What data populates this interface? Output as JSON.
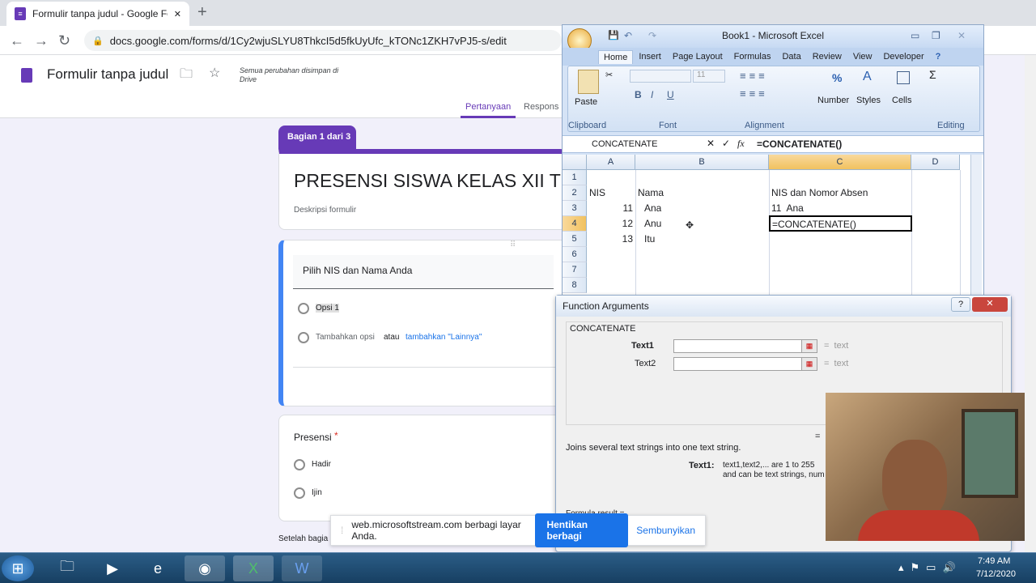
{
  "browser": {
    "tab_title": "Formulir tanpa judul - Google Fo",
    "tab_close": "✕",
    "new_tab": "+",
    "url": "docs.google.com/forms/d/1Cy2wjuSLYU8ThkcI5d5fkUyUfc_kTONc1ZKH7vPJ5-s/edit"
  },
  "forms": {
    "doc_title": "Formulir tanpa judul",
    "save_status": "Semua perubahan disimpan di Drive",
    "tabs": [
      "Pertanyaan",
      "Respons"
    ],
    "section_badge": "Bagian 1 dari 3",
    "form_title": "PRESENSI SISWA KELAS XII TEI",
    "form_description": "Deskripsi formulir",
    "question1": {
      "title": "Pilih NIS dan Nama Anda",
      "option1": "Opsi 1",
      "add_option": "Tambahkan opsi",
      "atau": "atau",
      "add_other": "tambahkan \"Lainnya\""
    },
    "question2": {
      "title": "Presensi",
      "required_mark": "*",
      "options": [
        "Hadir",
        "Ijin"
      ]
    },
    "after_section": "Setelah bagia"
  },
  "excel": {
    "title": "Book1 - Microsoft Excel",
    "ribbon_tabs": [
      "Home",
      "Insert",
      "Page Layout",
      "Formulas",
      "Data",
      "Review",
      "View",
      "Developer"
    ],
    "groups": {
      "clipboard": "Clipboard",
      "font": "Font",
      "alignment": "Alignment",
      "number": "Number",
      "styles": "Styles",
      "cells": "Cells",
      "editing": "Editing",
      "paste": "Paste",
      "font_size": "11"
    },
    "name_box": "CONCATENATE",
    "formula": "=CONCATENATE()",
    "columns": [
      "A",
      "B",
      "C",
      "D"
    ],
    "rows": [
      "1",
      "2",
      "3",
      "4",
      "5",
      "6",
      "7",
      "8"
    ],
    "cells": {
      "A2": "NIS",
      "B2": "Nama",
      "C2": "NIS dan Nomor Absen",
      "A3": "11",
      "B3": "Ana",
      "C3": "11  Ana",
      "A4": "12",
      "B4": "Anu",
      "C4": "=CONCATENATE()",
      "A5": "13",
      "B5": "Itu"
    }
  },
  "function_args": {
    "title": "Function Arguments",
    "function_name": "CONCATENATE",
    "arg1_label": "Text1",
    "arg2_label": "Text2",
    "arg_result": "=  text",
    "equals": "=",
    "description": "Joins several text strings into one text string.",
    "arg_help_label": "Text1:",
    "arg_help_line1": "text1,text2,... are 1 to 255",
    "arg_help_line2": "and can be text strings, num",
    "formula_result": "Formula result ="
  },
  "share_bar": {
    "message": "web.microsoftstream.com berbagi layar Anda.",
    "stop_button": "Hentikan berbagi",
    "hide_button": "Sembunyikan"
  },
  "taskbar": {
    "time": "7:49 AM",
    "date": "7/12/2020"
  },
  "colors": {
    "forms_purple": "#673ab7",
    "chrome_blue": "#1a73e8",
    "excel_blue": "#d5e3f6"
  }
}
